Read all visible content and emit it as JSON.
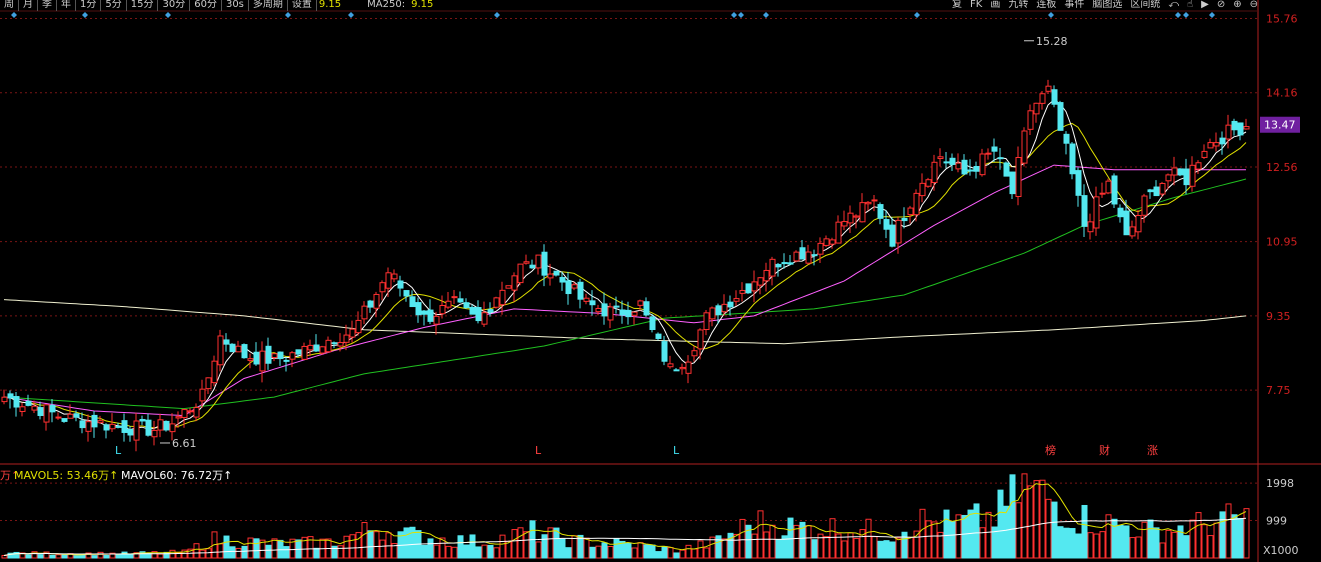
{
  "toolbar": {
    "tabs": [
      "周",
      "月",
      "季",
      "年",
      "1分",
      "5分",
      "15分",
      "30分",
      "60分",
      "30s",
      "多周期",
      "设置"
    ],
    "ma_value_partial": "9.15",
    "ma250_label": "MA250:",
    "ma250_value": "9.15",
    "right_items": [
      "复",
      "FK",
      "画",
      "九转",
      "连板",
      "事件",
      "脑图选",
      "区间统"
    ]
  },
  "chart_data": [
    {
      "type": "candlestick",
      "ylim": [
        6.2,
        15.9
      ],
      "y_ticks": [
        15.76,
        14.16,
        12.56,
        10.95,
        9.35,
        7.75
      ],
      "current_price": "13.47",
      "annotations": [
        {
          "text": "15.28",
          "value": 15.28,
          "bar_index": 170
        },
        {
          "text": "6.61",
          "value": 6.61,
          "bar_index": 26
        }
      ],
      "markers": [
        {
          "text": "L",
          "bar_index": 19,
          "color": "#40e0f0"
        },
        {
          "text": "L",
          "bar_index": 89,
          "color": "#ff4040"
        },
        {
          "text": "L",
          "bar_index": 112,
          "color": "#40e0f0"
        },
        {
          "text": "榜",
          "bar_index": 174,
          "color": "#ff4040"
        },
        {
          "text": "财",
          "bar_index": 183,
          "color": "#ff4040"
        },
        {
          "text": "涨",
          "bar_index": 191,
          "color": "#ff4040"
        }
      ],
      "ma_lines": {
        "MA5": "#ffffff",
        "MA10": "#e0e000",
        "MA20": "#ff60ff",
        "MA60": "#20c020",
        "MA250": "#f0f0d0"
      },
      "ma250_points": [
        [
          0,
          9.7
        ],
        [
          20,
          9.55
        ],
        [
          40,
          9.35
        ],
        [
          60,
          9.05
        ],
        [
          100,
          8.85
        ],
        [
          130,
          8.75
        ],
        [
          150,
          8.9
        ],
        [
          175,
          9.05
        ],
        [
          200,
          9.25
        ],
        [
          207,
          9.35
        ]
      ],
      "ma60_points": [
        [
          0,
          7.6
        ],
        [
          30,
          7.35
        ],
        [
          45,
          7.6
        ],
        [
          60,
          8.1
        ],
        [
          90,
          8.7
        ],
        [
          110,
          9.3
        ],
        [
          135,
          9.5
        ],
        [
          150,
          9.8
        ],
        [
          170,
          10.7
        ],
        [
          180,
          11.3
        ],
        [
          195,
          11.9
        ],
        [
          207,
          12.3
        ]
      ],
      "ma20_points": [
        [
          0,
          7.6
        ],
        [
          15,
          7.3
        ],
        [
          30,
          7.2
        ],
        [
          40,
          8.0
        ],
        [
          55,
          8.6
        ],
        [
          70,
          9.1
        ],
        [
          85,
          9.5
        ],
        [
          100,
          9.4
        ],
        [
          115,
          9.2
        ],
        [
          125,
          9.35
        ],
        [
          140,
          10.1
        ],
        [
          155,
          11.3
        ],
        [
          165,
          12.0
        ],
        [
          175,
          12.6
        ],
        [
          185,
          12.5
        ],
        [
          195,
          12.5
        ],
        [
          207,
          12.5
        ]
      ],
      "key_closes": [
        [
          0,
          7.6
        ],
        [
          5,
          7.4
        ],
        [
          10,
          7.15
        ],
        [
          15,
          7.05
        ],
        [
          20,
          6.95
        ],
        [
          25,
          6.9
        ],
        [
          28,
          7.05
        ],
        [
          33,
          7.6
        ],
        [
          36,
          8.9
        ],
        [
          40,
          8.5
        ],
        [
          45,
          8.4
        ],
        [
          50,
          8.6
        ],
        [
          55,
          8.9
        ],
        [
          58,
          9.0
        ],
        [
          61,
          9.6
        ],
        [
          64,
          10.3
        ],
        [
          67,
          9.8
        ],
        [
          70,
          9.3
        ],
        [
          75,
          9.6
        ],
        [
          79,
          9.2
        ],
        [
          82,
          9.8
        ],
        [
          86,
          10.4
        ],
        [
          89,
          10.5
        ],
        [
          93,
          10.1
        ],
        [
          97,
          9.6
        ],
        [
          102,
          9.4
        ],
        [
          106,
          9.6
        ],
        [
          108,
          9.0
        ],
        [
          111,
          8.2
        ],
        [
          114,
          8.5
        ],
        [
          117,
          9.3
        ],
        [
          120,
          9.6
        ],
        [
          124,
          10.0
        ],
        [
          127,
          10.4
        ],
        [
          130,
          10.6
        ],
        [
          135,
          10.8
        ],
        [
          140,
          11.4
        ],
        [
          145,
          11.8
        ],
        [
          148,
          11.0
        ],
        [
          152,
          12.1
        ],
        [
          156,
          12.8
        ],
        [
          160,
          12.4
        ],
        [
          165,
          12.9
        ],
        [
          168,
          12.0
        ],
        [
          171,
          13.8
        ],
        [
          174,
          14.2
        ],
        [
          177,
          12.9
        ],
        [
          180,
          11.3
        ],
        [
          184,
          12.2
        ],
        [
          187,
          11.0
        ],
        [
          190,
          11.8
        ],
        [
          194,
          12.4
        ],
        [
          197,
          12.3
        ],
        [
          200,
          13.0
        ],
        [
          204,
          13.3
        ],
        [
          207,
          13.47
        ]
      ]
    },
    {
      "type": "bar",
      "series_labels": [
        {
          "name": "MAVOL5",
          "text": "MAVOL5: 53.46万↑",
          "color": "#e0e000"
        },
        {
          "name": "MAVOL60",
          "text": "MAVOL60: 76.72万↑",
          "color": "#ffffff"
        }
      ],
      "leading_fragment": "万↑",
      "ylim": [
        0,
        2400
      ],
      "y_ticks": [
        1998,
        999
      ],
      "unit_label": "X1000",
      "volume_profile": [
        [
          0,
          120
        ],
        [
          20,
          110
        ],
        [
          30,
          150
        ],
        [
          35,
          500
        ],
        [
          45,
          380
        ],
        [
          55,
          420
        ],
        [
          58,
          600
        ],
        [
          62,
          800
        ],
        [
          66,
          650
        ],
        [
          72,
          500
        ],
        [
          80,
          420
        ],
        [
          88,
          700
        ],
        [
          95,
          450
        ],
        [
          105,
          350
        ],
        [
          112,
          200
        ],
        [
          118,
          400
        ],
        [
          125,
          950
        ],
        [
          132,
          800
        ],
        [
          140,
          800
        ],
        [
          148,
          650
        ],
        [
          152,
          1000
        ],
        [
          158,
          900
        ],
        [
          165,
          1100
        ],
        [
          170,
          1900
        ],
        [
          174,
          1600
        ],
        [
          178,
          1100
        ],
        [
          185,
          900
        ],
        [
          192,
          700
        ],
        [
          200,
          900
        ],
        [
          207,
          1100
        ]
      ]
    }
  ]
}
